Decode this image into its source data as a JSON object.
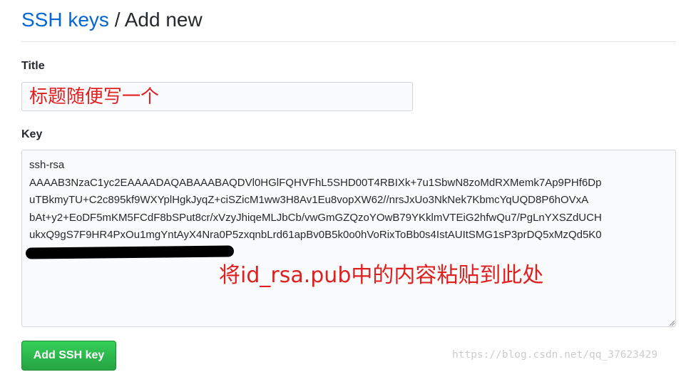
{
  "header": {
    "breadcrumb_link": "SSH keys",
    "separator": " / ",
    "current": "Add new"
  },
  "form": {
    "title_label": "Title",
    "title_annotation": "标题随便写一个",
    "key_label": "Key",
    "key_lines": [
      "ssh-rsa",
      "AAAAB3NzaC1yc2EAAAADAQABAAABAQDVl0HGlFQHVFhL5SHD00T4RBIXk+7u1SbwN8zoMdRXMemk7Ap9PHf6Dp",
      "uTBkmyTU+C2c895kf9WXYplHgkJyqZ+ciSZicM1ww3H8Av1Eu8vopXW62//nrsJxUo3NkNek7KbmcYqUQD8P6hOVxA",
      "bAt+y2+EoDF5mKM5FCdF8bSPut8cr/xVzyJhiqeMLJbCb/vwGmGZQzoYOwB79YKklmVTEiG2hfwQu7/PgLnYXSZdUCH",
      "ukxQ9gS7F9HR4PxOu1mgYntAyX4Nra0P5zxqnbLrd61apBv0B5k0o0hVoRixToBb0s4IstAUItSMG1sP3prDQ5xMzQd5K0"
    ],
    "key_annotation": "将id_rsa.pub中的内容粘贴到此处",
    "submit_label": "Add SSH key"
  },
  "watermark": "https://blog.csdn.net/qq_37623429",
  "colors": {
    "link": "#0366d6",
    "annotation": "#e02020",
    "button": "#28a745"
  }
}
